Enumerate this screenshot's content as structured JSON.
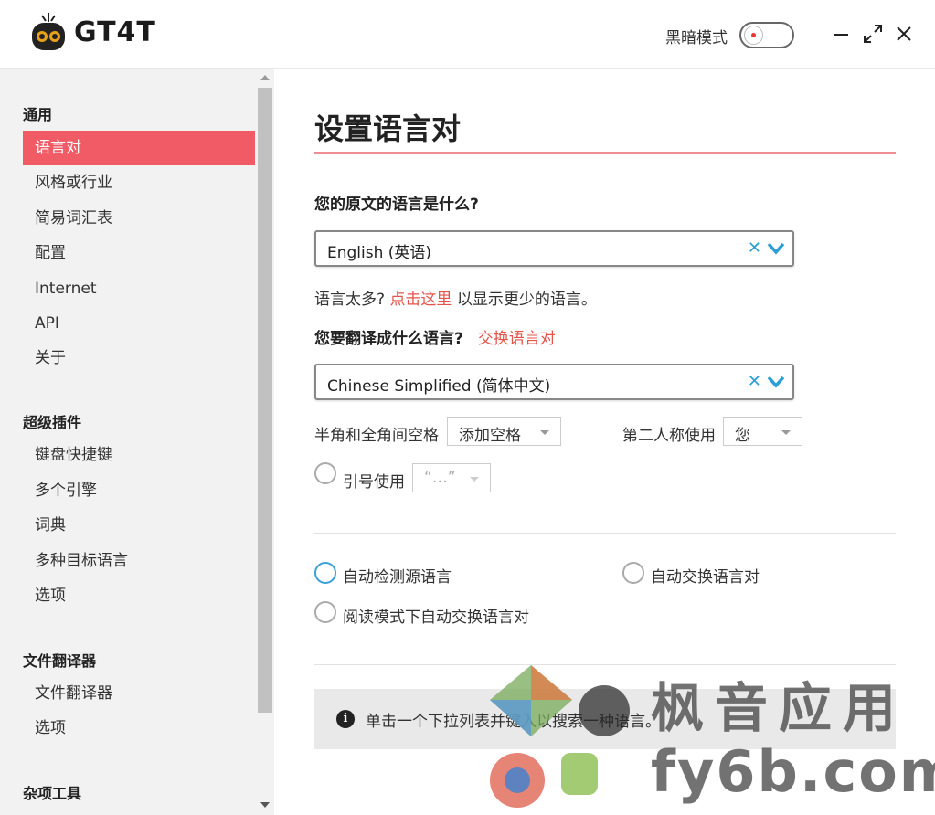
{
  "app": {
    "logo_text": "GT4T"
  },
  "header": {
    "dark_mode_label": "黑暗模式",
    "dark_mode_on": false
  },
  "colors": {
    "accent": "#f15b66",
    "link": "#e5534b",
    "clear": "#2a9fd6"
  },
  "sidebar": {
    "sections": [
      {
        "title": "通用",
        "items": [
          "语言对",
          "风格或行业",
          "简易词汇表",
          "配置",
          "Internet",
          "API",
          "关于"
        ]
      },
      {
        "title": "超级插件",
        "items": [
          "键盘快捷键",
          "多个引擎",
          "词典",
          "多种目标语言",
          "选项"
        ]
      },
      {
        "title": "文件翻译器",
        "items": [
          "文件翻译器",
          "选项"
        ]
      },
      {
        "title": "杂项工具",
        "items": []
      }
    ],
    "active_item": "语言对"
  },
  "main": {
    "title": "设置语言对",
    "source_question": "您的原文的语言是什么?",
    "source_value": "English (英语)",
    "hint_prefix": "语言太多?",
    "hint_link": "点击这里",
    "hint_suffix": "以显示更少的语言。",
    "target_question": "您要翻译成什么语言?",
    "swap_link": "交换语言对",
    "target_value": "Chinese Simplified (简体中文)",
    "space_label": "半角和全角间空格",
    "space_value": "添加空格",
    "person_label": "第二人称使用",
    "person_value": "您",
    "quote_label": "引号使用",
    "quote_value": "“…”",
    "auto_detect_label": "自动检测源语言",
    "auto_swap_label": "自动交换语言对",
    "reading_swap_label": "阅读模式下自动交换语言对",
    "info_text": "单击一个下拉列表并键入以搜索一种语言。"
  },
  "watermark": {
    "line1": "枫音应用",
    "line2": "fy6b.com"
  }
}
